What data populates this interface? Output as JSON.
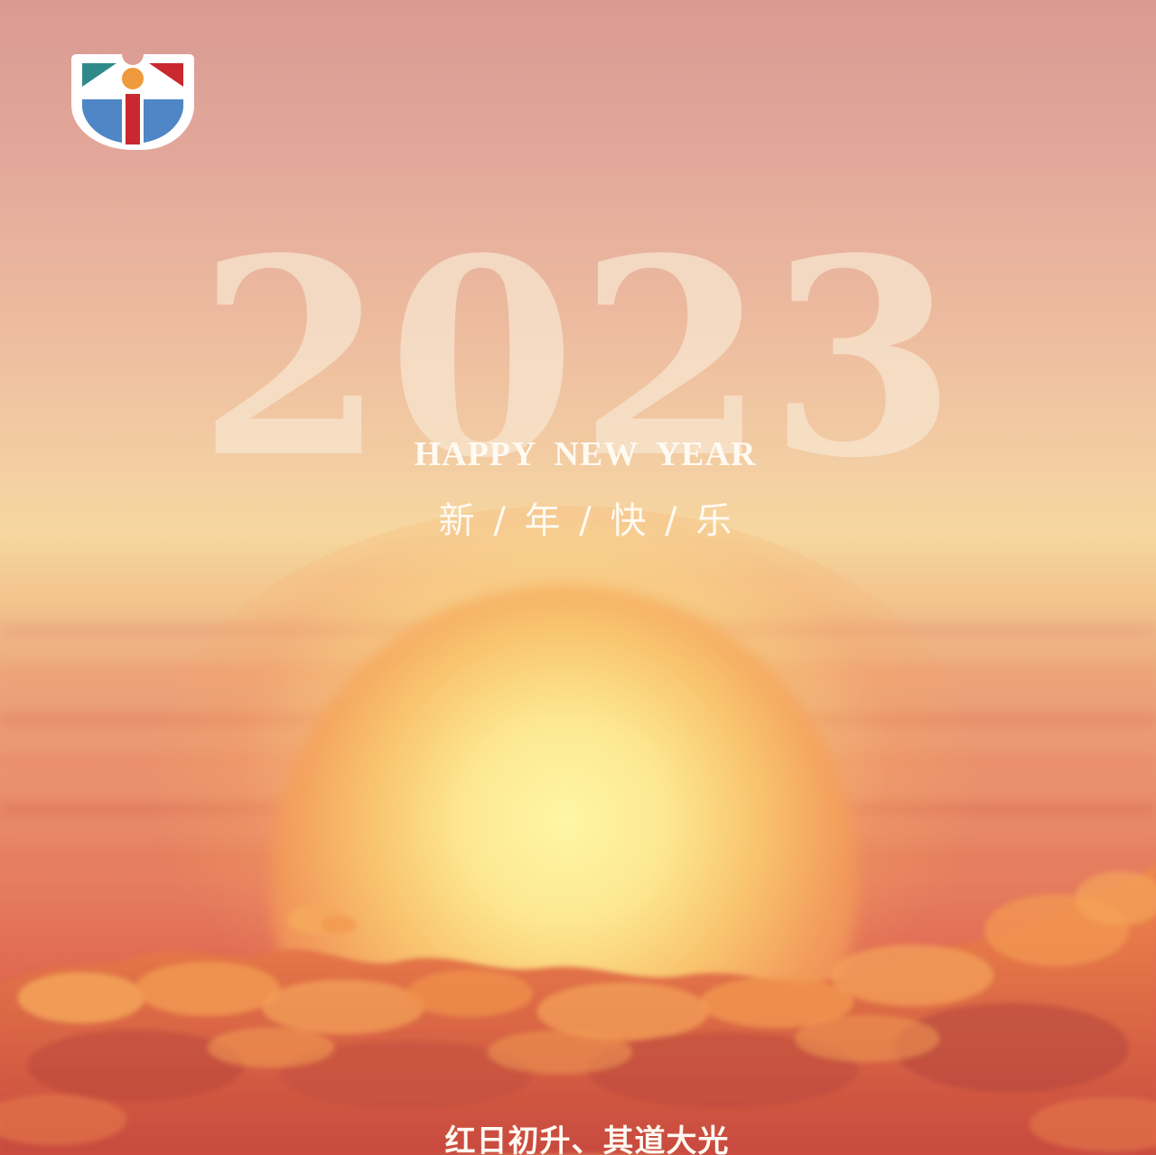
{
  "logo": {
    "name": "logo",
    "colors": {
      "teal": "#2e8a8a",
      "red": "#c8282e",
      "orange": "#ef9a3c",
      "blue": "#4f86c6",
      "frame": "#ffffff"
    }
  },
  "poster": {
    "year": "2023",
    "headline": "HAPPY NEW YEAR",
    "greeting": "新 / 年 / 快 / 乐",
    "tagline": "红日初升、其道大光"
  },
  "colors": {
    "sky_top": "#d99a92",
    "sky_mid": "#f6d79f",
    "sky_bottom": "#cf4f42",
    "sun": "#fde891",
    "cloud": "#e3703f",
    "cloud_highlight": "#f5a45a",
    "cloud_shadow": "#b9473d",
    "text": "#fffaf2",
    "year_text": "#f6e6d0"
  }
}
